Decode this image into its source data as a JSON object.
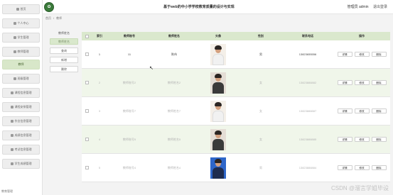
{
  "header": {
    "title": "基于web的中小学学校教育质量的设计与实现",
    "admin_text": "管理员 admin",
    "logout": "退出登录"
  },
  "sidebar": {
    "items": [
      {
        "label": "首页",
        "icon": "home-icon"
      },
      {
        "label": "个人中心",
        "icon": "person-icon"
      },
      {
        "label": "学生管理",
        "icon": "grid-icon"
      },
      {
        "label": "教师管理",
        "icon": "grid-icon"
      },
      {
        "label": "教师",
        "icon": "",
        "active": true
      },
      {
        "label": "班级管理",
        "icon": "grid-icon"
      },
      {
        "label": "课程信息管理",
        "icon": "grid-icon"
      },
      {
        "label": "课程安排管理",
        "icon": "grid-icon"
      },
      {
        "label": "作业信息管理",
        "icon": "grid-icon"
      },
      {
        "label": "成绩信息管理",
        "icon": "grid-icon"
      },
      {
        "label": "考试信息管理",
        "icon": "grid-icon"
      },
      {
        "label": "学生成绩管理",
        "icon": "grid-icon"
      }
    ],
    "footer_text": "教育管理"
  },
  "breadcrumb": {
    "home": "首页",
    "current": "教师"
  },
  "filter": {
    "label": "教师姓名",
    "input_placeholder": "教师姓名",
    "search": "查询",
    "add": "新增",
    "delete": "删除"
  },
  "table": {
    "headers": [
      "索引",
      "教师账号",
      "教师姓名",
      "头像",
      "性别",
      "联系电话",
      "操作"
    ],
    "rows": [
      {
        "index": "1",
        "no": "11",
        "name": "陈伟",
        "gender": "男",
        "phone": "13823655556"
      },
      {
        "index": "2",
        "no": "教师账号2",
        "name": "教师姓名2",
        "gender": "女",
        "phone": "13823888882"
      },
      {
        "index": "3",
        "no": "教师账号7",
        "name": "教师姓名7",
        "gender": "女",
        "phone": "13823888887"
      },
      {
        "index": "4",
        "no": "教师账号5",
        "name": "教师姓名5",
        "gender": "女",
        "phone": "13823888885"
      },
      {
        "index": "5",
        "no": "教师账号4",
        "name": "教师姓名4",
        "gender": "男",
        "phone": "13823888884"
      }
    ],
    "ops": [
      "详情",
      "修改",
      "删除"
    ]
  },
  "watermark": "CSDN @溜言学姐毕设"
}
